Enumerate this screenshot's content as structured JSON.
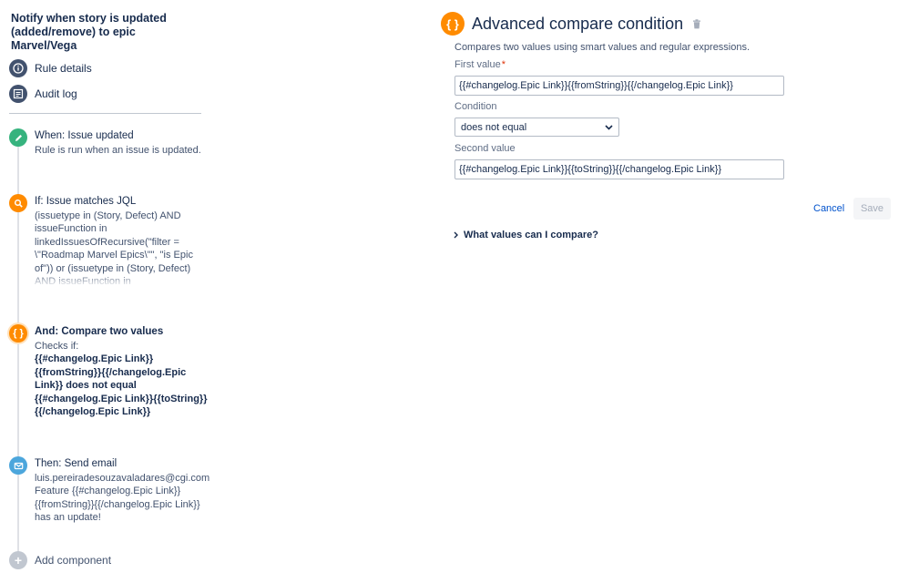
{
  "sidebar": {
    "rule_title": "Notify when story is updated (added/remove) to epic Marvel/Vega",
    "nav": [
      {
        "label": "Rule details",
        "icon": "info-icon"
      },
      {
        "label": "Audit log",
        "icon": "list-icon"
      }
    ],
    "steps": {
      "when": {
        "title": "When: Issue updated",
        "desc": "Rule is run when an issue is updated.",
        "icon": "pencil-icon",
        "color": "#36b37e"
      },
      "if": {
        "title": "If: Issue matches JQL",
        "desc": "(issuetype in (Story, Defect) AND issueFunction in linkedIssuesOfRecursive(\"filter = \\\"Roadmap Marvel Epics\\\"\", \"is Epic of\")) or (issuetype in (Story, Defect) AND issueFunction in linkedIssuesOfRecursive",
        "icon": "search-icon",
        "color": "#ff8b00"
      },
      "and": {
        "title": "And: Compare two values",
        "checks": "Checks if:",
        "desc": "{{#changelog.Epic Link}}{{fromString}}{{/changelog.Epic Link}} does not equal {{#changelog.Epic Link}}{{toString}}{{/changelog.Epic Link}}",
        "icon": "braces-icon",
        "color": "#ff8b00"
      },
      "then": {
        "title": "Then: Send email",
        "email": "luis.pereiradesouzavaladares@cgi.com",
        "desc": "Feature {{#changelog.Epic Link}}{{fromString}}{{/changelog.Epic Link}} has an update!",
        "icon": "mail-icon",
        "color": "#4ca6dc"
      }
    },
    "add_component": "Add component"
  },
  "panel": {
    "icon_glyph": "{ }",
    "title": "Advanced compare condition",
    "description": "Compares two values using smart values and regular expressions.",
    "first_value_label": "First value",
    "required_mark": "*",
    "first_value": "{{#changelog.Epic Link}}{{fromString}}{{/changelog.Epic Link}}",
    "condition_label": "Condition",
    "condition_value": "does not equal",
    "second_value_label": "Second value",
    "second_value": "{{#changelog.Epic Link}}{{toString}}{{/changelog.Epic Link}}",
    "cancel_label": "Cancel",
    "save_label": "Save",
    "expander_label": "What values can I compare?"
  },
  "colors": {
    "accent_orange": "#ff8b00",
    "link_blue": "#0052cc",
    "success_green": "#36b37e",
    "mail_blue": "#4ca6dc"
  }
}
